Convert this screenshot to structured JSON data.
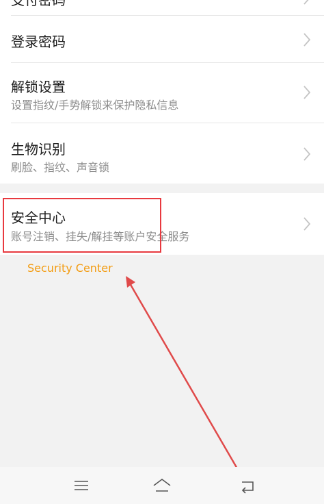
{
  "settings": {
    "items": [
      {
        "title": "支付密码",
        "subtitle": ""
      },
      {
        "title": "登录密码",
        "subtitle": ""
      },
      {
        "title": "解锁设置",
        "subtitle": "设置指纹/手势解锁来保护隐私信息"
      },
      {
        "title": "生物识别",
        "subtitle": "刷脸、指纹、声音锁"
      },
      {
        "title": "安全中心",
        "subtitle": "账号注销、挂失/解挂等账户安全服务"
      }
    ]
  },
  "annotation": {
    "label": "Security Center",
    "highlight_color": "#e8393f",
    "label_color": "#f39c12"
  },
  "navbar": {
    "icons": [
      "menu-icon",
      "home-icon",
      "back-icon"
    ]
  }
}
